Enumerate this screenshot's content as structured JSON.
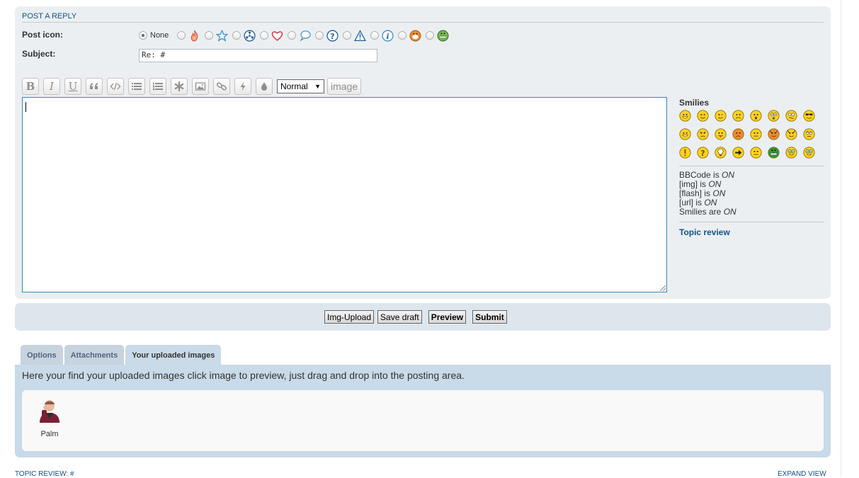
{
  "panel": {
    "title": "POST A REPLY",
    "post_icon_label": "Post icon:",
    "post_icon_none_label": "None",
    "post_icons": [
      "fire-icon",
      "star-icon",
      "radioactive-icon",
      "heart-icon",
      "speech-bubble-icon",
      "question-icon",
      "warning-icon",
      "info-icon",
      "mrgreen-icon",
      "grin-icon"
    ],
    "subject_label": "Subject:",
    "subject_value": "Re: #"
  },
  "toolbar": {
    "bold": "B",
    "italic": "I",
    "underline": "U",
    "font_size_selected": "Normal",
    "image_button": "image"
  },
  "sidebar": {
    "smilies_title": "Smilies",
    "smilies": [
      "very-happy",
      "smile",
      "wink",
      "sad",
      "surprised",
      "shocked",
      "confused",
      "cool",
      "laughing",
      "mad",
      "razz",
      "embarrassed",
      "neutral",
      "twisted-evil",
      "evil",
      "rolling-eyes",
      "exclamation",
      "question",
      "idea",
      "arrow",
      "neutral2",
      "mrgreen",
      "geek",
      "uber-geek"
    ],
    "status": [
      {
        "prefix": "BBCode is ",
        "value": "ON"
      },
      {
        "prefix": "[img] is ",
        "value": "ON"
      },
      {
        "prefix": "[flash] is ",
        "value": "ON"
      },
      {
        "prefix": "[url] is ",
        "value": "ON"
      },
      {
        "prefix": "Smilies are ",
        "value": "ON"
      }
    ],
    "topic_review": "Topic review"
  },
  "buttons": {
    "img_upload": "Img-Upload",
    "save_draft": "Save draft",
    "preview": "Preview",
    "submit": "Submit"
  },
  "tabs": [
    "Options",
    "Attachments",
    "Your uploaded images"
  ],
  "active_tab": "Your uploaded images",
  "uploads": {
    "description": "Here your find your uploaded images click image to preview, just drag and drop into the posting area.",
    "items": [
      {
        "label": "Palm"
      }
    ]
  },
  "footer": {
    "left": "TOPIC REVIEW: #",
    "right": "EXPAND VIEW"
  },
  "colors": {
    "link": "#105289",
    "panel_bg": "#ebeff2",
    "submit_bg": "#dde6ed",
    "tab_bg": "#c9dae8",
    "editor_border": "#2f8bbd"
  }
}
